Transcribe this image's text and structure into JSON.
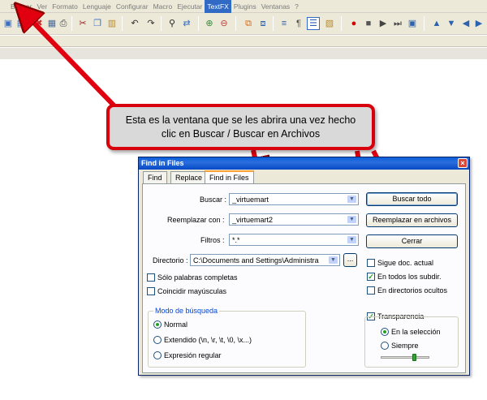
{
  "menu": {
    "items": [
      "Buscar",
      "Ver",
      "Formato",
      "Lenguaje",
      "Configurar",
      "Macro",
      "Ejecutar",
      "TextFX",
      "Plugins",
      "Ventanas",
      "?"
    ]
  },
  "toolbar": {
    "icons": [
      "new-file-icon",
      "open-file-icon",
      "save-icon",
      "save-all-icon",
      "close-icon",
      "close-all-icon",
      "print-icon",
      "cut-icon",
      "copy-icon",
      "paste-icon",
      "undo-icon",
      "redo-icon",
      "find-icon",
      "replace-icon",
      "zoom-in-icon",
      "zoom-out-icon",
      "sync-vertical-icon",
      "sync-horizontal-icon",
      "word-wrap-icon",
      "show-all-chars-icon",
      "indent-guide-icon",
      "user-language-icon",
      "record-macro-icon",
      "stop-macro-icon",
      "play-macro-icon",
      "run-macro-multiple-icon",
      "save-macro-icon",
      "up-arrow-icon",
      "down-arrow-icon",
      "pointer-icon"
    ]
  },
  "callout": {
    "text": "Esta es la ventana que se les abrira una vez hecho clic en Buscar / Buscar en Archivos"
  },
  "dialog": {
    "title": "Find in Files",
    "close_glyph": "×",
    "tabs": [
      "Find",
      "Replace",
      "Find in Files"
    ],
    "search_label": "Buscar :",
    "search_value": "_virtuemart",
    "replace_label": "Reemplazar con :",
    "replace_value": "_virtuemart2",
    "filters_label": "Filtros :",
    "filters_value": "*.*",
    "directory_label": "Directorio :",
    "directory_value": "C:\\Documents and Settings\\Administra",
    "browse_label": "...",
    "buttons": {
      "find_all": "Buscar todo",
      "replace_in_files": "Reemplazar en archivos",
      "close": "Cerrar"
    },
    "checkboxes": {
      "whole_words": {
        "label": "Sólo palabras completas",
        "checked": false
      },
      "match_case": {
        "label": "Coincidir mayúsculas",
        "checked": false
      },
      "follow_current": {
        "label": "Sigue doc. actual",
        "checked": false
      },
      "all_subdirs": {
        "label": "En todos los subdir.",
        "checked": true
      },
      "hidden_dirs": {
        "label": "En directorios ocultos",
        "checked": false
      },
      "transparency": {
        "label": "Transparencia",
        "checked": true
      }
    },
    "search_mode": {
      "title": "Modo de búsqueda",
      "options": [
        "Normal",
        "Extendido (\\n, \\r, \\t, \\0, \\x...)",
        "Expresión regular"
      ],
      "selected": "Normal"
    },
    "transparency_options": {
      "options": [
        "En la selección",
        "Siempre"
      ],
      "selected": "En la selección",
      "slider_level": 0.7
    },
    "check_glyph": "✓",
    "drop_glyph": "▼"
  },
  "colors": {
    "callout_border": "#d8000c",
    "arrow": "#e0000f",
    "titlebar": "#0a5fd8",
    "tab_highlight": "#f9a13a",
    "group_title": "#0046d5"
  }
}
